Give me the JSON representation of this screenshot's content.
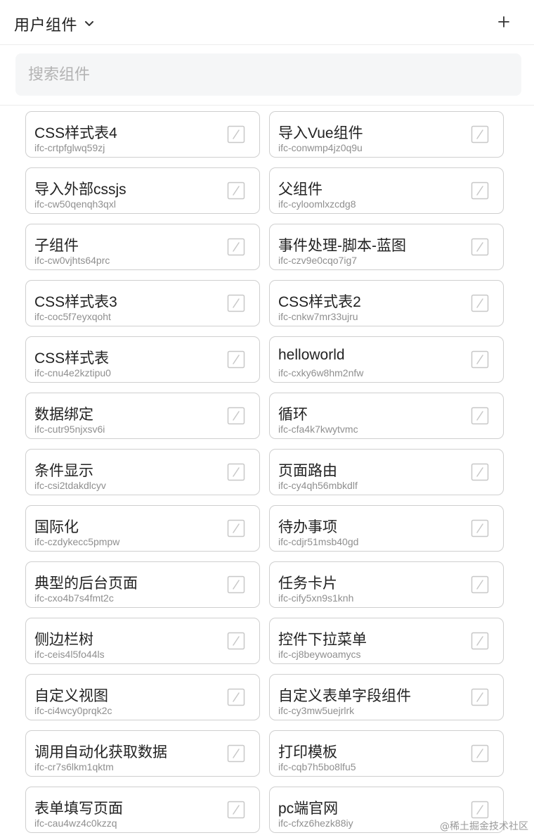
{
  "header": {
    "title": "用户组件",
    "add_symbol": "+"
  },
  "search": {
    "placeholder": "搜索组件",
    "value": ""
  },
  "components": [
    {
      "name": "CSS样式表4",
      "id": "ifc-crtpfglwq59zj"
    },
    {
      "name": "导入Vue组件",
      "id": "ifc-conwmp4jz0q9u"
    },
    {
      "name": "导入外部cssjs",
      "id": "ifc-cw50qenqh3qxl"
    },
    {
      "name": "父组件",
      "id": "ifc-cyloomlxzcdg8"
    },
    {
      "name": "子组件",
      "id": "ifc-cw0vjhts64prc"
    },
    {
      "name": "事件处理-脚本-蓝图",
      "id": "ifc-czv9e0cqo7ig7"
    },
    {
      "name": "CSS样式表3",
      "id": "ifc-coc5f7eyxqoht"
    },
    {
      "name": "CSS样式表2",
      "id": "ifc-cnkw7mr33ujru"
    },
    {
      "name": "CSS样式表",
      "id": "ifc-cnu4e2kztipu0"
    },
    {
      "name": "helloworld",
      "id": "ifc-cxky6w8hm2nfw"
    },
    {
      "name": "数据绑定",
      "id": "ifc-cutr95njxsv6i"
    },
    {
      "name": "循环",
      "id": "ifc-cfa4k7kwytvmc"
    },
    {
      "name": "条件显示",
      "id": "ifc-csi2tdakdlcyv"
    },
    {
      "name": "页面路由",
      "id": "ifc-cy4qh56mbkdlf"
    },
    {
      "name": "国际化",
      "id": "ifc-czdykecc5pmpw"
    },
    {
      "name": "待办事项",
      "id": "ifc-cdjr51msb40gd"
    },
    {
      "name": "典型的后台页面",
      "id": "ifc-cxo4b7s4fmt2c"
    },
    {
      "name": "任务卡片",
      "id": "ifc-cify5xn9s1knh"
    },
    {
      "name": "侧边栏树",
      "id": "ifc-ceis4l5fo44ls"
    },
    {
      "name": "控件下拉菜单",
      "id": "ifc-cj8beywoamycs"
    },
    {
      "name": "自定义视图",
      "id": "ifc-ci4wcy0prqk2c"
    },
    {
      "name": "自定义表单字段组件",
      "id": "ifc-cy3mw5uejrlrk"
    },
    {
      "name": "调用自动化获取数据",
      "id": "ifc-cr7s6lkm1qktm"
    },
    {
      "name": "打印模板",
      "id": "ifc-cqb7h5bo8lfu5"
    },
    {
      "name": "表单填写页面",
      "id": "ifc-cau4wz4c0kzzq"
    },
    {
      "name": "pc端官网",
      "id": "ifc-cfxz6hezk88iy"
    }
  ],
  "watermark": "@稀土掘金技术社区",
  "colors": {
    "card_border": "#cfcfcf",
    "icon_stroke": "#c8c8c8",
    "id_text": "#8f8f8f",
    "search_bg": "#f5f6f7"
  },
  "icons": {
    "header_dropdown": "chevron-down-icon",
    "header_add": "plus-icon",
    "card_action": "edit-icon"
  }
}
